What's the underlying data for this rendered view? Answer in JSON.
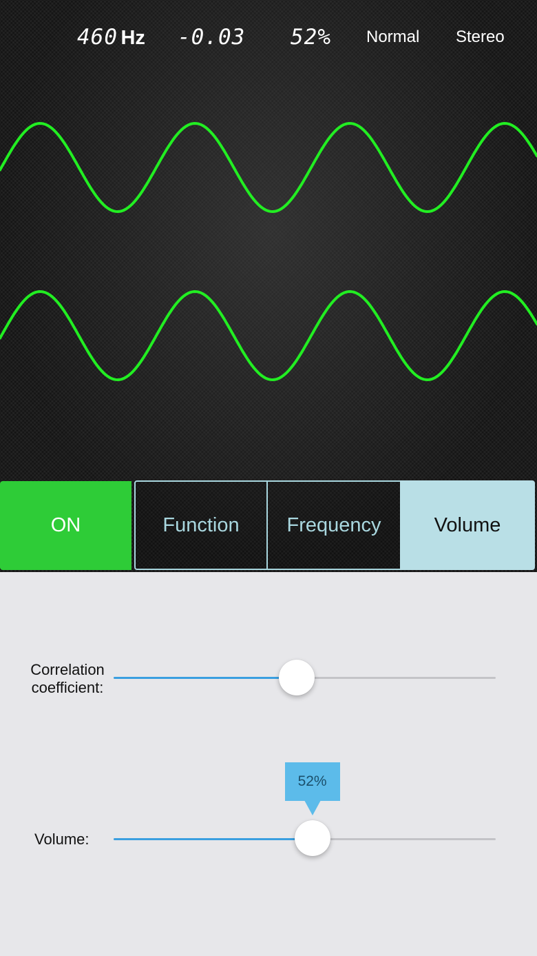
{
  "header": {
    "frequency_value": "460",
    "frequency_unit": "Hz",
    "phase_value": "-0.03",
    "volume_value": "52%",
    "mode": "Normal",
    "channel": "Stereo"
  },
  "scope": {
    "wave_color": "#22ee22",
    "background_color": "#141414"
  },
  "tabs": {
    "on_label": "ON",
    "function_label": "Function",
    "frequency_label": "Frequency",
    "volume_label": "Volume",
    "selected": "Volume",
    "on_color": "#2ecc37",
    "selected_color": "#b9dfe6"
  },
  "controls": {
    "correlation": {
      "label_line1": "Correlation",
      "label_line2": "coefficient:",
      "position_fraction": 0.48
    },
    "volume": {
      "label": "Volume:",
      "value_fraction": 0.52,
      "bubble_text": "52%"
    },
    "accent_color": "#3a9fe0"
  }
}
